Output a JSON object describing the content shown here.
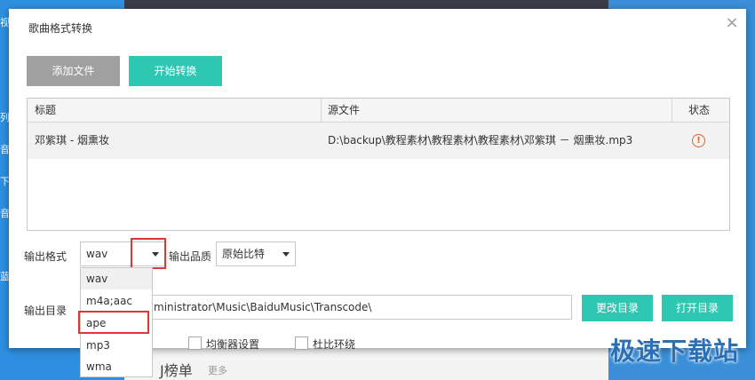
{
  "background": {
    "sidebar_glyphs": [
      "视",
      "列",
      "音",
      "下",
      "音",
      "蓝"
    ],
    "rank_title": "J榜单",
    "more_link": "更多",
    "watermark": "极速下载站"
  },
  "dialog": {
    "title": "歌曲格式转换",
    "close_symbol": "×",
    "add_file_label": "添加文件",
    "start_convert_label": "开始转换",
    "table": {
      "columns": [
        "标题",
        "源文件",
        "状态"
      ],
      "rows": [
        {
          "title": "邓紫琪 - 烟熏妆",
          "source": "D:\\backup\\教程素材\\教程素材\\教程素材\\邓紫琪 － 烟熏妆.mp3",
          "status_icon": "!"
        }
      ]
    },
    "output_format": {
      "label": "输出格式",
      "value": "wav",
      "options": [
        "wav",
        "m4a;aac",
        "ape",
        "mp3",
        "wma"
      ],
      "highlighted_option": "ape"
    },
    "output_quality": {
      "label": "输出品质",
      "value": "原始比特"
    },
    "output_dir": {
      "label": "输出目录",
      "visible_path": "ministrator\\Music\\BaiduMusic\\Transcode\\",
      "change_label": "更改目录",
      "open_label": "打开目录"
    },
    "equalizer_label": "均衡器设置",
    "dolby_label": "杜比环绕"
  },
  "colors": {
    "accent": "#2ec7b2",
    "highlight": "#e03535",
    "button_disabled": "#a0a0a0"
  }
}
